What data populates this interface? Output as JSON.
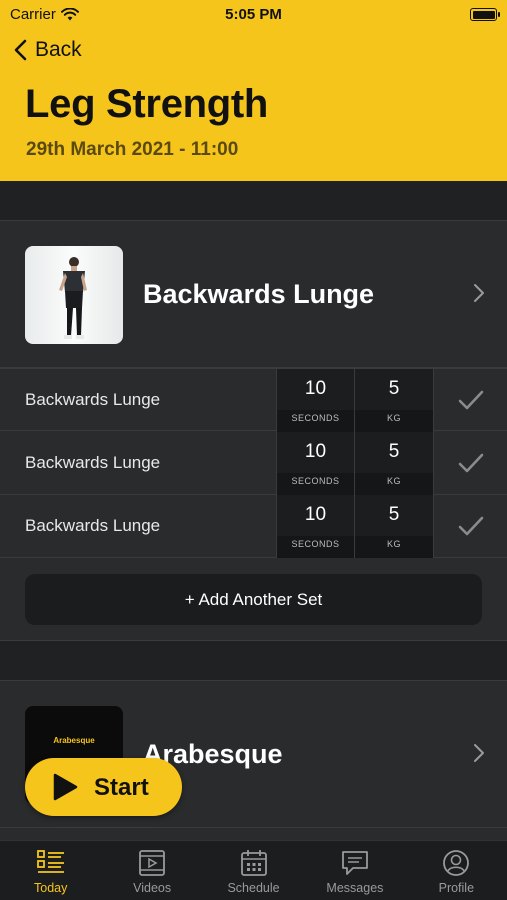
{
  "status_bar": {
    "carrier": "Carrier",
    "time": "5:05 PM"
  },
  "nav": {
    "back_label": "Back"
  },
  "workout": {
    "title": "Leg Strength",
    "datetime": "29th March 2021 - 11:00"
  },
  "exercises": [
    {
      "name": "Backwards Lunge",
      "sets": [
        {
          "name": "Backwards Lunge",
          "duration": "10",
          "duration_unit": "SECONDS",
          "weight": "5",
          "weight_unit": "KG"
        },
        {
          "name": "Backwards Lunge",
          "duration": "10",
          "duration_unit": "SECONDS",
          "weight": "5",
          "weight_unit": "KG"
        },
        {
          "name": "Backwards Lunge",
          "duration": "10",
          "duration_unit": "SECONDS",
          "weight": "5",
          "weight_unit": "KG"
        }
      ],
      "add_set_label": "+ Add Another Set"
    },
    {
      "name": "Arabesque",
      "thumbnail_text": "Arabesque"
    }
  ],
  "start_button": {
    "label": "Start"
  },
  "tabs": [
    {
      "label": "Today",
      "icon": "list-icon",
      "active": true
    },
    {
      "label": "Videos",
      "icon": "video-icon"
    },
    {
      "label": "Schedule",
      "icon": "calendar-icon"
    },
    {
      "label": "Messages",
      "icon": "message-icon"
    },
    {
      "label": "Profile",
      "icon": "profile-icon"
    }
  ],
  "colors": {
    "accent": "#f6c51c",
    "background": "#2a2b2d",
    "tab_bar": "#1c1d1f"
  }
}
